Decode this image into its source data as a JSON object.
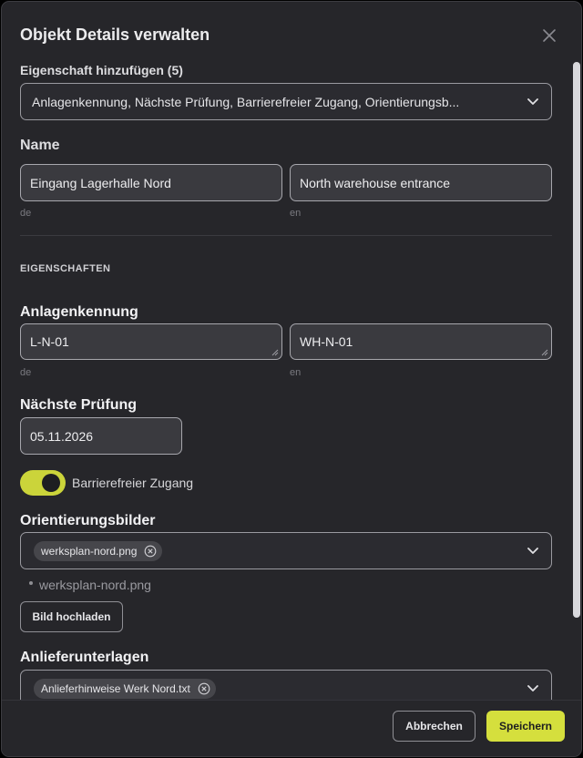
{
  "dialog": {
    "title": "Objekt Details verwalten",
    "close_icon": "close-icon"
  },
  "properties_select": {
    "label": "Eigenschaft hinzufügen (5)",
    "value": "Anlagenkennung, Nächste Prüfung, Barrierefreier Zugang, Orientierungsb..."
  },
  "name": {
    "label": "Name",
    "de_value": "Eingang Lagerhalle Nord",
    "de_lang": "de",
    "en_value": "North warehouse entrance",
    "en_lang": "en"
  },
  "section_caption": "EIGENSCHAFTEN",
  "asset_id": {
    "label": "Anlagenkennung",
    "de_value": "L-N-01",
    "de_lang": "de",
    "en_value": "WH-N-01",
    "en_lang": "en"
  },
  "next_inspection": {
    "label": "Nächste Prüfung",
    "value": "05.11.2026"
  },
  "accessible_access": {
    "label": "Barrierefreier Zugang",
    "enabled": true,
    "accent_color": "#cbd43a"
  },
  "orientation_images": {
    "label": "Orientierungsbilder",
    "chip": "werksplan-nord.png",
    "file_item": "werksplan-nord.png",
    "upload_button": "Bild hochladen"
  },
  "delivery_docs": {
    "label": "Anlieferunterlagen",
    "chip": "Anlieferhinweise Werk Nord.txt"
  },
  "footer": {
    "cancel_label": "Abbrechen",
    "save_label": "Speichern",
    "save_color": "#d5df3d"
  }
}
